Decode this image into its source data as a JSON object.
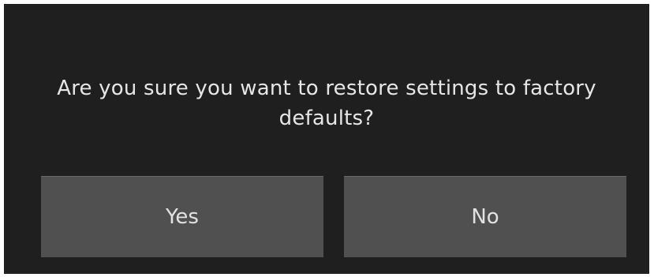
{
  "dialog": {
    "message": "Are you sure you want to restore settings to factory defaults?",
    "yes_label": "Yes",
    "no_label": "No"
  },
  "colors": {
    "dialog_background": "#1f1f1f",
    "button_background": "#505050",
    "text": "#e6e6e6"
  }
}
